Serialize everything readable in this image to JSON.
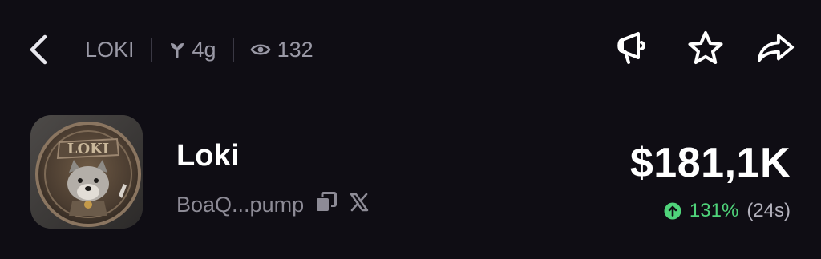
{
  "header": {
    "ticker": "LOKI",
    "age": "4g",
    "views": "132",
    "icons": {
      "back": "chevron-left-icon",
      "age": "sprout-icon",
      "views": "eye-icon",
      "promote": "megaphone-icon",
      "favorite": "star-icon",
      "share": "share-arrow-icon"
    }
  },
  "token": {
    "name": "Loki",
    "address": "BoaQ...pump",
    "avatar_text": "LOKI",
    "market_cap": "$181,1K",
    "change_pct": "131%",
    "change_window": "(24s)",
    "icons": {
      "copy": "copy-icon",
      "x": "x-logo-icon",
      "up": "arrow-up-circle-icon"
    }
  },
  "colors": {
    "background": "#0f0d14",
    "muted_text": "#9a99a6",
    "positive": "#4fd37a"
  }
}
